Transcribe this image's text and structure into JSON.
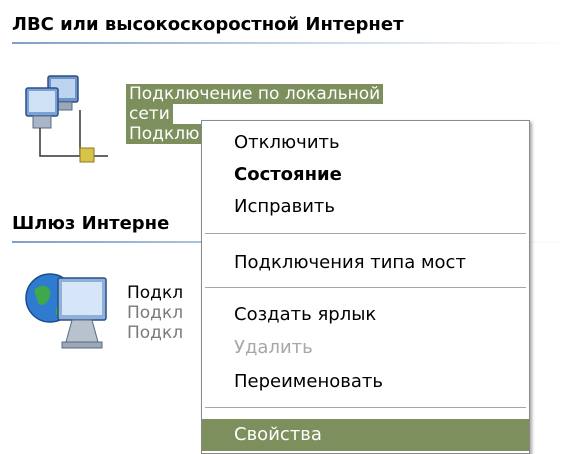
{
  "groups": {
    "lan_title": "ЛВС или высокоскоростной Интернет",
    "gateway_title": "Шлюз Интерне"
  },
  "lan_connection": {
    "name_line1": "Подключение по локальной",
    "name_line2": "сети",
    "status_partial": "Подклю"
  },
  "internet_connection": {
    "name_partial": "Подкл",
    "line2_partial": "Подкл",
    "line3_partial": "Подкл"
  },
  "context_menu": {
    "items": [
      {
        "label": "Отключить",
        "state": "normal"
      },
      {
        "label": "Состояние",
        "state": "default"
      },
      {
        "label": "Исправить",
        "state": "normal"
      },
      {
        "label": "Подключения типа мост",
        "state": "normal"
      },
      {
        "label": "Создать ярлык",
        "state": "normal"
      },
      {
        "label": "Удалить",
        "state": "disabled"
      },
      {
        "label": "Переименовать",
        "state": "normal"
      },
      {
        "label": "Свойства",
        "state": "highlighted"
      }
    ]
  },
  "colors": {
    "selection": "#7c8f5c",
    "header_line": "#7fa0c8"
  },
  "icons": {
    "lan": "network-computers-icon",
    "internet": "internet-gateway-icon"
  }
}
